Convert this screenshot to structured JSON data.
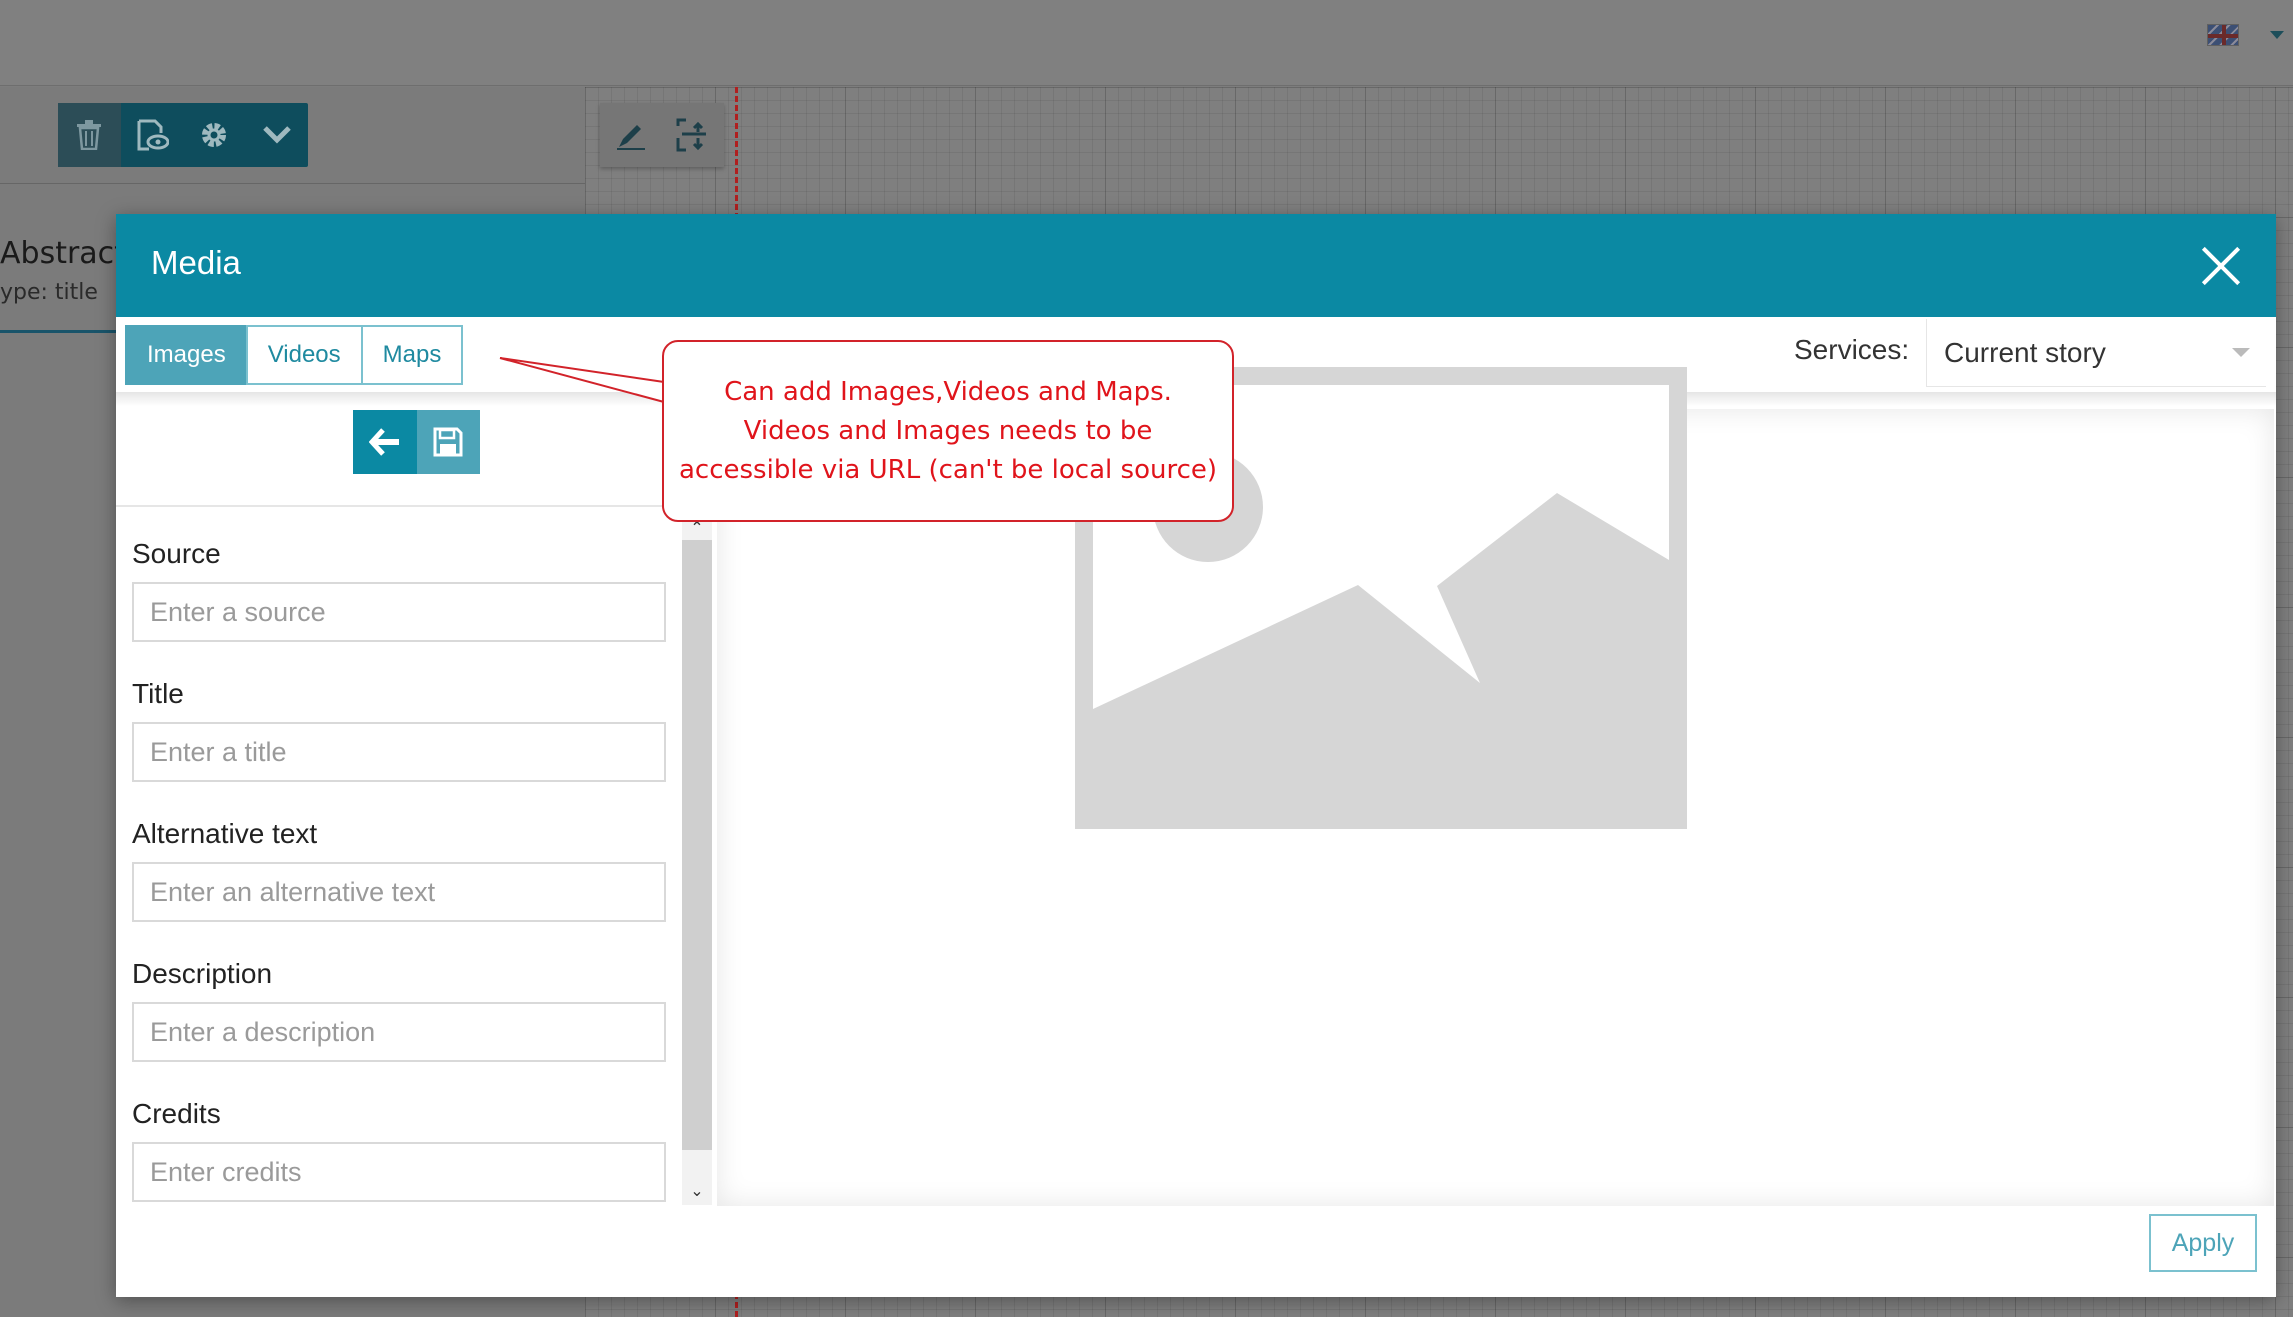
{
  "background": {
    "block_toolbar": [
      "trash-icon",
      "preview-icon",
      "gear-icon",
      "chevron-down-icon"
    ],
    "edit_toolbar": [
      "pencil-icon",
      "snap-grid-icon"
    ],
    "abstract_block": {
      "title": "Abstract",
      "type_label": "ype: title"
    }
  },
  "modal": {
    "title": "Media",
    "tabs": [
      {
        "label": "Images",
        "active": true
      },
      {
        "label": "Videos",
        "active": false
      },
      {
        "label": "Maps",
        "active": false
      }
    ],
    "services": {
      "label": "Services:",
      "selected": "Current story"
    },
    "fields": [
      {
        "label": "Source",
        "placeholder": "Enter a source"
      },
      {
        "label": "Title",
        "placeholder": "Enter a title"
      },
      {
        "label": "Alternative text",
        "placeholder": "Enter an alternative text"
      },
      {
        "label": "Description",
        "placeholder": "Enter a description"
      },
      {
        "label": "Credits",
        "placeholder": "Enter credits"
      }
    ],
    "apply_label": "Apply"
  },
  "annotation": {
    "text": "Can add Images,Videos and Maps.\nVideos and Images needs to be\naccessible via URL (can't be local source)"
  },
  "colors": {
    "header": "#0b89a3",
    "tab_active": "#4da4b8",
    "annotation": "#e0141b",
    "placeholder_image": "#d6d6d6"
  }
}
